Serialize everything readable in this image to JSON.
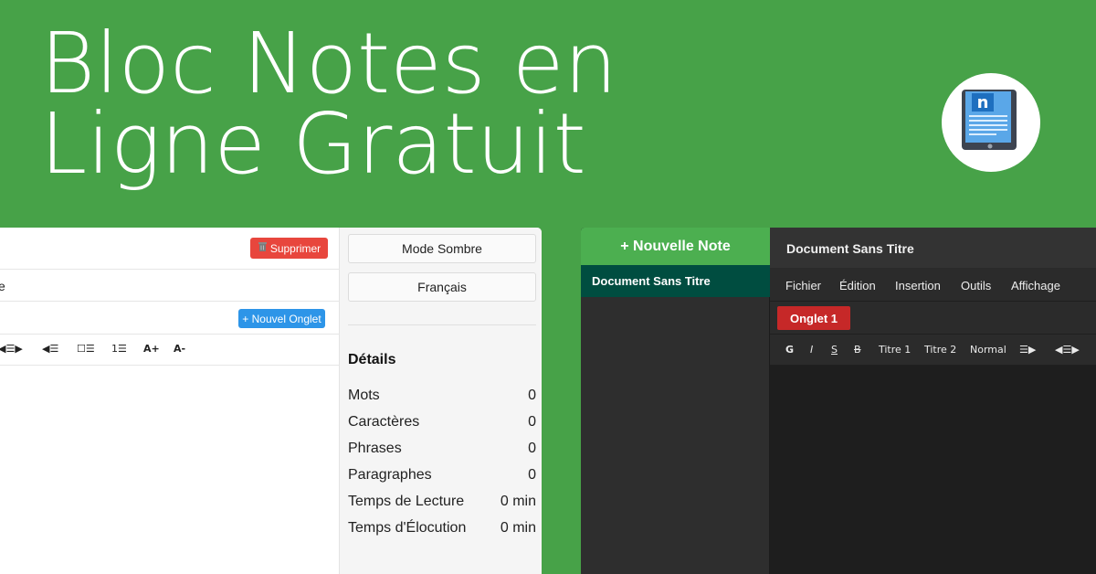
{
  "hero": {
    "title_line1": "Bloc Notes en",
    "title_line2": "Ligne Gratuit"
  },
  "logo": {
    "icon": "notepad-tablet-icon",
    "letter": "n"
  },
  "light_app": {
    "delete_button": "Supprimer",
    "delete_icon": "trash-icon",
    "menu_fragment": "e",
    "new_tab_button": "+ Nouvel Onglet",
    "toolbar": [
      "◀☰▶",
      "◀☰",
      "☐☰",
      "1☰",
      "A+",
      "A-"
    ],
    "side": {
      "dark_mode_button": "Mode Sombre",
      "language_button": "Français",
      "details_title": "Détails",
      "stats": [
        {
          "label": "Mots",
          "value": "0"
        },
        {
          "label": "Caractères",
          "value": "0"
        },
        {
          "label": "Phrases",
          "value": "0"
        },
        {
          "label": "Paragraphes",
          "value": "0"
        },
        {
          "label": "Temps de Lecture",
          "value": "0 min"
        },
        {
          "label": "Temps d'Élocution",
          "value": "0 min"
        }
      ]
    }
  },
  "dark_app": {
    "new_note_button": "+ Nouvelle Note",
    "notes": [
      "Document Sans Titre"
    ],
    "doc_title": "Document Sans Titre",
    "menu": [
      "Fichier",
      "Édition",
      "Insertion",
      "Outils",
      "Affichage"
    ],
    "tabs": [
      "Onglet 1"
    ],
    "toolbar": [
      "G",
      "I",
      "S",
      "B",
      "Titre 1",
      "Titre 2",
      "Normal",
      "☰▶",
      "◀☰▶"
    ]
  },
  "colors": {
    "background": "#47a248",
    "delete": "#e8463d",
    "new_tab": "#2d95e8",
    "new_note": "#4caf50",
    "active_note": "#004d40",
    "active_tab": "#c62828"
  }
}
